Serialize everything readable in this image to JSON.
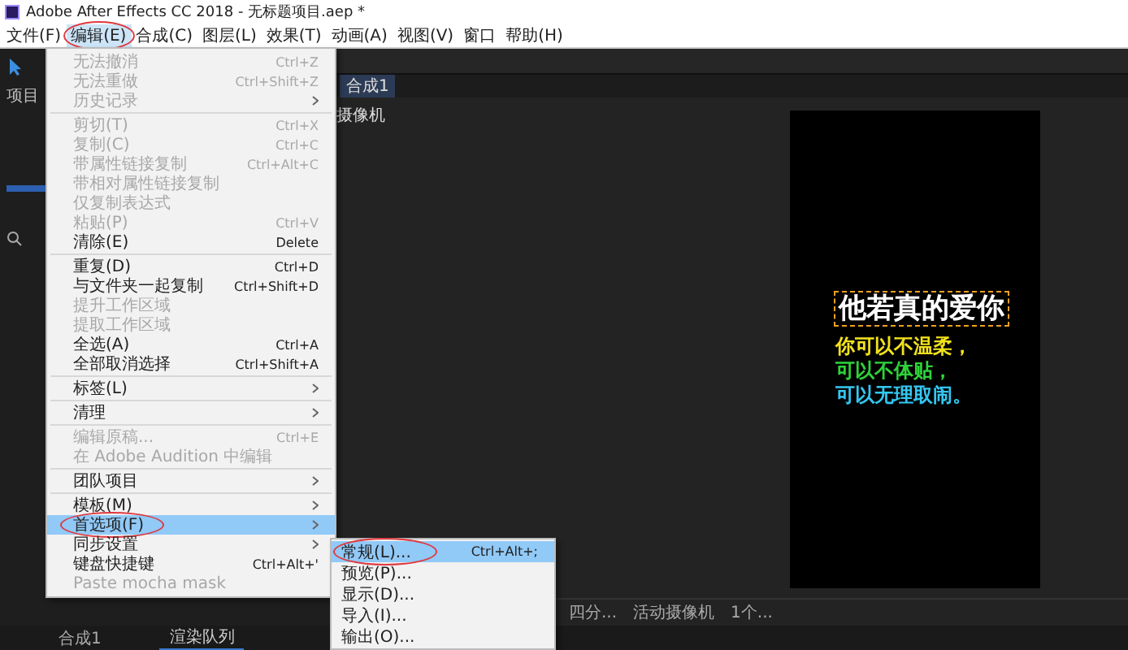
{
  "window": {
    "title": "Adobe After Effects CC 2018 - 无标题项目.aep *"
  },
  "menubar": [
    {
      "label": "文件(F)",
      "selected": false,
      "circled": false
    },
    {
      "label": "编辑(E)",
      "selected": true,
      "circled": true
    },
    {
      "label": "合成(C)",
      "selected": false,
      "circled": false
    },
    {
      "label": "图层(L)",
      "selected": false,
      "circled": false
    },
    {
      "label": "效果(T)",
      "selected": false,
      "circled": false
    },
    {
      "label": "动画(A)",
      "selected": false,
      "circled": false
    },
    {
      "label": "视图(V)",
      "selected": false,
      "circled": false
    },
    {
      "label": "窗口",
      "selected": false,
      "circled": false
    },
    {
      "label": "帮助(H)",
      "selected": false,
      "circled": false
    }
  ],
  "project_panel": {
    "tab": "项目"
  },
  "viewer": {
    "tab": "合成1",
    "camera_label": "摄像机",
    "toolbar": [
      "四分...",
      "活动摄像机",
      "1个..."
    ]
  },
  "composition": {
    "lines": [
      {
        "text": "他若真的爱你",
        "color": "#ffffff"
      },
      {
        "text": "你可以不温柔，",
        "color": "#f2e21c"
      },
      {
        "text": "可以不体贴，",
        "color": "#2fd23a"
      },
      {
        "text": "可以无理取闹。",
        "color": "#34c6f0"
      }
    ]
  },
  "bottom_tabs": [
    {
      "label": "合成1",
      "selected": false
    },
    {
      "label": "渲染队列",
      "selected": true
    }
  ],
  "edit_menu": {
    "items": [
      {
        "kind": "item",
        "label": "无法撤消",
        "shortcut": "Ctrl+Z",
        "disabled": true,
        "submenu": false,
        "selected": false,
        "circled": false
      },
      {
        "kind": "item",
        "label": "无法重做",
        "shortcut": "Ctrl+Shift+Z",
        "disabled": true,
        "submenu": false,
        "selected": false,
        "circled": false
      },
      {
        "kind": "item",
        "label": "历史记录",
        "disabled": true,
        "submenu": true,
        "selected": false,
        "circled": false
      },
      {
        "kind": "separator"
      },
      {
        "kind": "item",
        "label": "剪切(T)",
        "shortcut": "Ctrl+X",
        "disabled": true,
        "submenu": false,
        "selected": false,
        "circled": false
      },
      {
        "kind": "item",
        "label": "复制(C)",
        "shortcut": "Ctrl+C",
        "disabled": true,
        "submenu": false,
        "selected": false,
        "circled": false
      },
      {
        "kind": "item",
        "label": "带属性链接复制",
        "shortcut": "Ctrl+Alt+C",
        "disabled": true,
        "submenu": false,
        "selected": false,
        "circled": false
      },
      {
        "kind": "item",
        "label": "带相对属性链接复制",
        "disabled": true,
        "submenu": false,
        "selected": false,
        "circled": false
      },
      {
        "kind": "item",
        "label": "仅复制表达式",
        "disabled": true,
        "submenu": false,
        "selected": false,
        "circled": false
      },
      {
        "kind": "item",
        "label": "粘贴(P)",
        "shortcut": "Ctrl+V",
        "disabled": true,
        "submenu": false,
        "selected": false,
        "circled": false
      },
      {
        "kind": "item",
        "label": "清除(E)",
        "shortcut": "Delete",
        "disabled": false,
        "submenu": false,
        "selected": false,
        "circled": false
      },
      {
        "kind": "separator"
      },
      {
        "kind": "item",
        "label": "重复(D)",
        "shortcut": "Ctrl+D",
        "disabled": false,
        "submenu": false,
        "selected": false,
        "circled": false
      },
      {
        "kind": "item",
        "label": "与文件夹一起复制",
        "shortcut": "Ctrl+Shift+D",
        "disabled": false,
        "submenu": false,
        "selected": false,
        "circled": false
      },
      {
        "kind": "item",
        "label": "提升工作区域",
        "disabled": true,
        "submenu": false,
        "selected": false,
        "circled": false
      },
      {
        "kind": "item",
        "label": "提取工作区域",
        "disabled": true,
        "submenu": false,
        "selected": false,
        "circled": false
      },
      {
        "kind": "item",
        "label": "全选(A)",
        "shortcut": "Ctrl+A",
        "disabled": false,
        "submenu": false,
        "selected": false,
        "circled": false
      },
      {
        "kind": "item",
        "label": "全部取消选择",
        "shortcut": "Ctrl+Shift+A",
        "disabled": false,
        "submenu": false,
        "selected": false,
        "circled": false
      },
      {
        "kind": "separator"
      },
      {
        "kind": "item",
        "label": "标签(L)",
        "disabled": false,
        "submenu": true,
        "selected": false,
        "circled": false
      },
      {
        "kind": "separator"
      },
      {
        "kind": "item",
        "label": "清理",
        "disabled": false,
        "submenu": true,
        "selected": false,
        "circled": false
      },
      {
        "kind": "separator"
      },
      {
        "kind": "item",
        "label": "编辑原稿...",
        "shortcut": "Ctrl+E",
        "disabled": true,
        "submenu": false,
        "selected": false,
        "circled": false
      },
      {
        "kind": "item",
        "label": "在 Adobe Audition 中编辑",
        "disabled": true,
        "submenu": false,
        "selected": false,
        "circled": false
      },
      {
        "kind": "separator"
      },
      {
        "kind": "item",
        "label": "团队项目",
        "disabled": false,
        "submenu": true,
        "selected": false,
        "circled": false
      },
      {
        "kind": "separator"
      },
      {
        "kind": "item",
        "label": "模板(M)",
        "disabled": false,
        "submenu": true,
        "selected": false,
        "circled": false
      },
      {
        "kind": "item",
        "label": "首选项(F)",
        "disabled": false,
        "submenu": true,
        "selected": true,
        "circled": true
      },
      {
        "kind": "item",
        "label": "同步设置",
        "disabled": false,
        "submenu": true,
        "selected": false,
        "circled": false
      },
      {
        "kind": "item",
        "label": "键盘快捷键",
        "shortcut": "Ctrl+Alt+'",
        "disabled": false,
        "submenu": false,
        "selected": false,
        "circled": false
      },
      {
        "kind": "item",
        "label": "Paste mocha mask",
        "disabled": true,
        "submenu": false,
        "selected": false,
        "circled": false
      }
    ]
  },
  "preferences_submenu": {
    "items": [
      {
        "label": "常规(L)...",
        "shortcut": "Ctrl+Alt+;",
        "selected": true,
        "circled": true
      },
      {
        "label": "预览(P)...",
        "selected": false,
        "circled": false
      },
      {
        "label": "显示(D)...",
        "selected": false,
        "circled": false
      },
      {
        "label": "导入(I)...",
        "selected": false,
        "circled": false
      },
      {
        "label": "输出(O)...",
        "selected": false,
        "circled": false
      }
    ]
  }
}
